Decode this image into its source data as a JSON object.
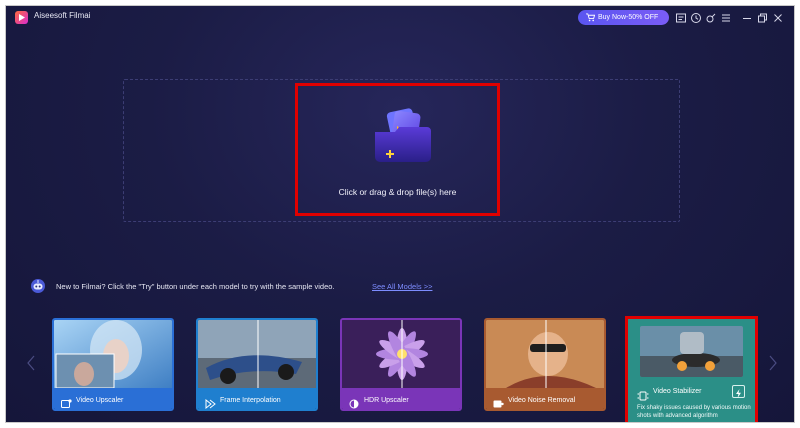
{
  "app": {
    "title": "Aiseesoft Filmai"
  },
  "header": {
    "buy_button_label": "Buy Now-50% OFF",
    "icons": [
      "register-icon",
      "history-icon",
      "tools-icon",
      "menu-icon",
      "minimize-icon",
      "restore-icon",
      "close-icon"
    ]
  },
  "dropzone": {
    "text": "Click or drag & drop file(s) here"
  },
  "tip": {
    "text": "New to Filmai? Click the \"Try\" button under each model to try with the sample video.",
    "link_label": "See All Models >>"
  },
  "models": [
    {
      "label": "Video Upscaler",
      "color": "#2a6fd6"
    },
    {
      "label": "Frame Interpolation",
      "color": "#1f7fcf"
    },
    {
      "label": "HDR Upscaler",
      "color": "#7a35b8"
    },
    {
      "label": "Video Noise Removal",
      "color": "#a85a30"
    },
    {
      "label": "Video Stabilizer",
      "color": "#2b8f87",
      "description": "Fix shaky issues caused by various motion shots with advanced algorithm"
    }
  ],
  "colors": {
    "accent": "#6b5cf6",
    "link": "#7d8cff",
    "highlight": "#e00000"
  }
}
